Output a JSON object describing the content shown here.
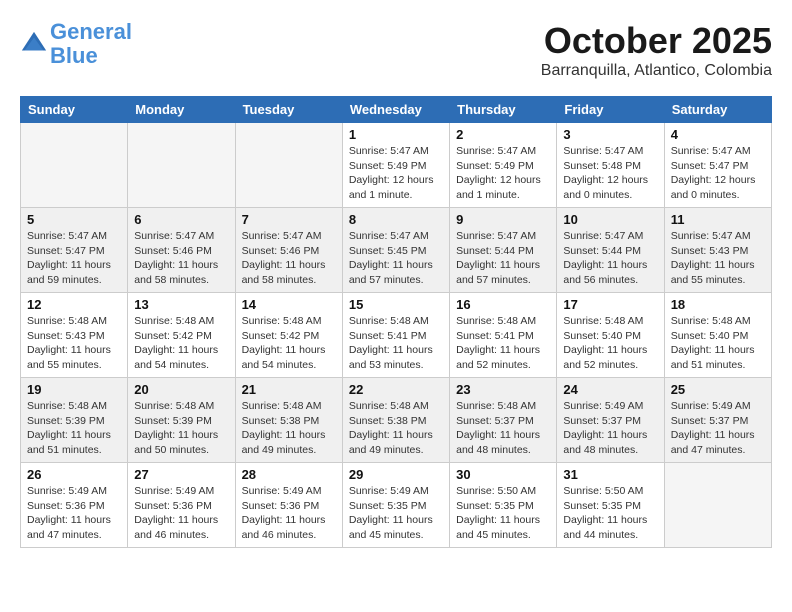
{
  "header": {
    "logo_line1": "General",
    "logo_line2": "Blue",
    "month": "October 2025",
    "location": "Barranquilla, Atlantico, Colombia"
  },
  "weekdays": [
    "Sunday",
    "Monday",
    "Tuesday",
    "Wednesday",
    "Thursday",
    "Friday",
    "Saturday"
  ],
  "weeks": [
    [
      {
        "day": "",
        "empty": true
      },
      {
        "day": "",
        "empty": true
      },
      {
        "day": "",
        "empty": true
      },
      {
        "day": "1",
        "sunrise": "5:47 AM",
        "sunset": "5:49 PM",
        "daylight": "12 hours and 1 minute."
      },
      {
        "day": "2",
        "sunrise": "5:47 AM",
        "sunset": "5:49 PM",
        "daylight": "12 hours and 1 minute."
      },
      {
        "day": "3",
        "sunrise": "5:47 AM",
        "sunset": "5:48 PM",
        "daylight": "12 hours and 0 minutes."
      },
      {
        "day": "4",
        "sunrise": "5:47 AM",
        "sunset": "5:47 PM",
        "daylight": "12 hours and 0 minutes."
      }
    ],
    [
      {
        "day": "5",
        "sunrise": "5:47 AM",
        "sunset": "5:47 PM",
        "daylight": "11 hours and 59 minutes."
      },
      {
        "day": "6",
        "sunrise": "5:47 AM",
        "sunset": "5:46 PM",
        "daylight": "11 hours and 58 minutes."
      },
      {
        "day": "7",
        "sunrise": "5:47 AM",
        "sunset": "5:46 PM",
        "daylight": "11 hours and 58 minutes."
      },
      {
        "day": "8",
        "sunrise": "5:47 AM",
        "sunset": "5:45 PM",
        "daylight": "11 hours and 57 minutes."
      },
      {
        "day": "9",
        "sunrise": "5:47 AM",
        "sunset": "5:44 PM",
        "daylight": "11 hours and 57 minutes."
      },
      {
        "day": "10",
        "sunrise": "5:47 AM",
        "sunset": "5:44 PM",
        "daylight": "11 hours and 56 minutes."
      },
      {
        "day": "11",
        "sunrise": "5:47 AM",
        "sunset": "5:43 PM",
        "daylight": "11 hours and 55 minutes."
      }
    ],
    [
      {
        "day": "12",
        "sunrise": "5:48 AM",
        "sunset": "5:43 PM",
        "daylight": "11 hours and 55 minutes."
      },
      {
        "day": "13",
        "sunrise": "5:48 AM",
        "sunset": "5:42 PM",
        "daylight": "11 hours and 54 minutes."
      },
      {
        "day": "14",
        "sunrise": "5:48 AM",
        "sunset": "5:42 PM",
        "daylight": "11 hours and 54 minutes."
      },
      {
        "day": "15",
        "sunrise": "5:48 AM",
        "sunset": "5:41 PM",
        "daylight": "11 hours and 53 minutes."
      },
      {
        "day": "16",
        "sunrise": "5:48 AM",
        "sunset": "5:41 PM",
        "daylight": "11 hours and 52 minutes."
      },
      {
        "day": "17",
        "sunrise": "5:48 AM",
        "sunset": "5:40 PM",
        "daylight": "11 hours and 52 minutes."
      },
      {
        "day": "18",
        "sunrise": "5:48 AM",
        "sunset": "5:40 PM",
        "daylight": "11 hours and 51 minutes."
      }
    ],
    [
      {
        "day": "19",
        "sunrise": "5:48 AM",
        "sunset": "5:39 PM",
        "daylight": "11 hours and 51 minutes."
      },
      {
        "day": "20",
        "sunrise": "5:48 AM",
        "sunset": "5:39 PM",
        "daylight": "11 hours and 50 minutes."
      },
      {
        "day": "21",
        "sunrise": "5:48 AM",
        "sunset": "5:38 PM",
        "daylight": "11 hours and 49 minutes."
      },
      {
        "day": "22",
        "sunrise": "5:48 AM",
        "sunset": "5:38 PM",
        "daylight": "11 hours and 49 minutes."
      },
      {
        "day": "23",
        "sunrise": "5:48 AM",
        "sunset": "5:37 PM",
        "daylight": "11 hours and 48 minutes."
      },
      {
        "day": "24",
        "sunrise": "5:49 AM",
        "sunset": "5:37 PM",
        "daylight": "11 hours and 48 minutes."
      },
      {
        "day": "25",
        "sunrise": "5:49 AM",
        "sunset": "5:37 PM",
        "daylight": "11 hours and 47 minutes."
      }
    ],
    [
      {
        "day": "26",
        "sunrise": "5:49 AM",
        "sunset": "5:36 PM",
        "daylight": "11 hours and 47 minutes."
      },
      {
        "day": "27",
        "sunrise": "5:49 AM",
        "sunset": "5:36 PM",
        "daylight": "11 hours and 46 minutes."
      },
      {
        "day": "28",
        "sunrise": "5:49 AM",
        "sunset": "5:36 PM",
        "daylight": "11 hours and 46 minutes."
      },
      {
        "day": "29",
        "sunrise": "5:49 AM",
        "sunset": "5:35 PM",
        "daylight": "11 hours and 45 minutes."
      },
      {
        "day": "30",
        "sunrise": "5:50 AM",
        "sunset": "5:35 PM",
        "daylight": "11 hours and 45 minutes."
      },
      {
        "day": "31",
        "sunrise": "5:50 AM",
        "sunset": "5:35 PM",
        "daylight": "11 hours and 44 minutes."
      },
      {
        "day": "",
        "empty": true
      }
    ]
  ],
  "labels": {
    "sunrise": "Sunrise:",
    "sunset": "Sunset:",
    "daylight": "Daylight:"
  }
}
